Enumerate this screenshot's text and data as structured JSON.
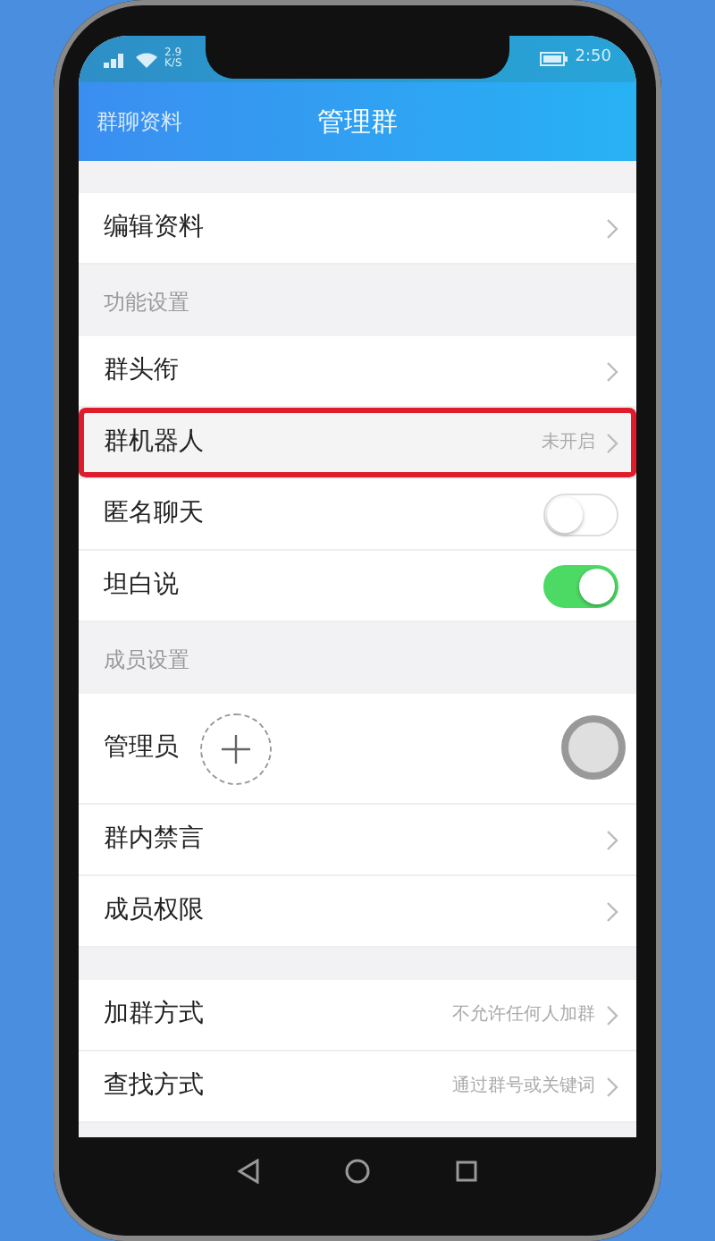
{
  "status_bar": {
    "network": "2.9\nK/S",
    "time": "2:50"
  },
  "header": {
    "back_label": "群聊资料",
    "title": "管理群"
  },
  "sections": [
    {
      "rows": [
        {
          "kind": "link",
          "label": "编辑资料",
          "highlighted": false
        }
      ]
    },
    {
      "title": "功能设置",
      "rows": [
        {
          "kind": "link",
          "label": "群头衔",
          "highlighted": false
        },
        {
          "kind": "link",
          "label": "群机器人",
          "value": "未开启",
          "highlighted": true
        },
        {
          "kind": "switch",
          "label": "匿名聊天",
          "on": false,
          "highlighted": false
        },
        {
          "kind": "switch",
          "label": "坦白说",
          "on": true,
          "highlighted": false
        }
      ]
    },
    {
      "title": "成员设置",
      "rows": [
        {
          "kind": "admin",
          "label": "管理员",
          "highlighted": false
        },
        {
          "kind": "link",
          "label": "群内禁言",
          "highlighted": false
        },
        {
          "kind": "link",
          "label": "成员权限",
          "highlighted": false
        }
      ]
    },
    {
      "rows": [
        {
          "kind": "link",
          "label": "加群方式",
          "value": "不允许任何人加群",
          "highlighted": false
        },
        {
          "kind": "link",
          "label": "查找方式",
          "value": "通过群号或关键词",
          "highlighted": false
        }
      ]
    }
  ]
}
